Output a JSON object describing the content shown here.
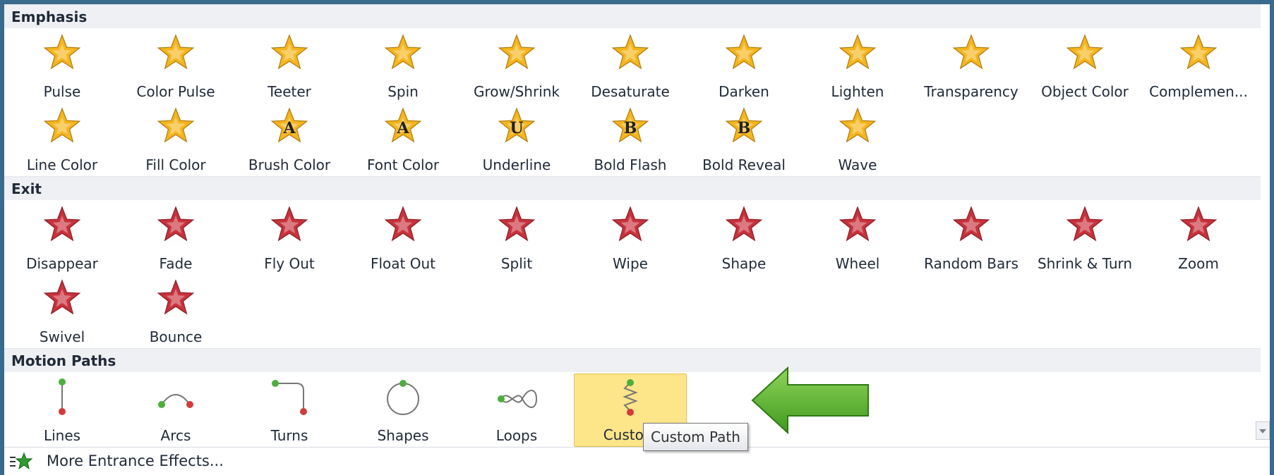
{
  "sections": {
    "emphasis": "Emphasis",
    "exit": "Exit",
    "motion_paths": "Motion Paths"
  },
  "emphasis": [
    {
      "label": "Pulse",
      "icon": "pulse-star-icon"
    },
    {
      "label": "Color Pulse",
      "icon": "color-pulse-star-icon"
    },
    {
      "label": "Teeter",
      "icon": "teeter-star-icon"
    },
    {
      "label": "Spin",
      "icon": "spin-star-icon"
    },
    {
      "label": "Grow/Shrink",
      "icon": "grow-shrink-star-icon"
    },
    {
      "label": "Desaturate",
      "icon": "desaturate-star-icon"
    },
    {
      "label": "Darken",
      "icon": "darken-star-icon"
    },
    {
      "label": "Lighten",
      "icon": "lighten-star-icon"
    },
    {
      "label": "Transparency",
      "icon": "transparency-star-icon"
    },
    {
      "label": "Object Color",
      "icon": "object-color-star-icon"
    },
    {
      "label": "Complemen...",
      "icon": "complementary-color-star-icon"
    },
    {
      "label": "Line Color",
      "icon": "line-color-star-icon"
    },
    {
      "label": "Fill Color",
      "icon": "fill-color-star-icon"
    },
    {
      "label": "Brush Color",
      "icon": "brush-color-star-icon",
      "glyph": "A"
    },
    {
      "label": "Font Color",
      "icon": "font-color-star-icon",
      "glyph": "A"
    },
    {
      "label": "Underline",
      "icon": "underline-star-icon",
      "glyph": "U"
    },
    {
      "label": "Bold Flash",
      "icon": "bold-flash-star-icon",
      "glyph": "B"
    },
    {
      "label": "Bold Reveal",
      "icon": "bold-reveal-star-icon",
      "glyph": "B"
    },
    {
      "label": "Wave",
      "icon": "wave-star-icon"
    }
  ],
  "exit": [
    {
      "label": "Disappear",
      "icon": "disappear-star-icon"
    },
    {
      "label": "Fade",
      "icon": "fade-star-icon"
    },
    {
      "label": "Fly Out",
      "icon": "fly-out-star-icon"
    },
    {
      "label": "Float Out",
      "icon": "float-out-star-icon"
    },
    {
      "label": "Split",
      "icon": "split-star-icon"
    },
    {
      "label": "Wipe",
      "icon": "wipe-star-icon"
    },
    {
      "label": "Shape",
      "icon": "shape-star-icon"
    },
    {
      "label": "Wheel",
      "icon": "wheel-star-icon"
    },
    {
      "label": "Random Bars",
      "icon": "random-bars-star-icon"
    },
    {
      "label": "Shrink & Turn",
      "icon": "shrink-turn-star-icon"
    },
    {
      "label": "Zoom",
      "icon": "zoom-star-icon"
    },
    {
      "label": "Swivel",
      "icon": "swivel-star-icon"
    },
    {
      "label": "Bounce",
      "icon": "bounce-star-icon"
    }
  ],
  "motion_paths": [
    {
      "label": "Lines",
      "icon": "lines-path-icon"
    },
    {
      "label": "Arcs",
      "icon": "arcs-path-icon"
    },
    {
      "label": "Turns",
      "icon": "turns-path-icon"
    },
    {
      "label": "Shapes",
      "icon": "shapes-path-icon"
    },
    {
      "label": "Loops",
      "icon": "loops-path-icon"
    },
    {
      "label": "Custom",
      "icon": "custom-path-icon",
      "selected": true
    }
  ],
  "tooltip": "Custom Path",
  "footer": {
    "label": "More Entrance Effects...",
    "icon": "entrance-star-icon"
  },
  "colors": {
    "gold": "#f5b51d",
    "red": "#c8323c",
    "arrow": "#5fb834",
    "selected": "#fde58a"
  }
}
